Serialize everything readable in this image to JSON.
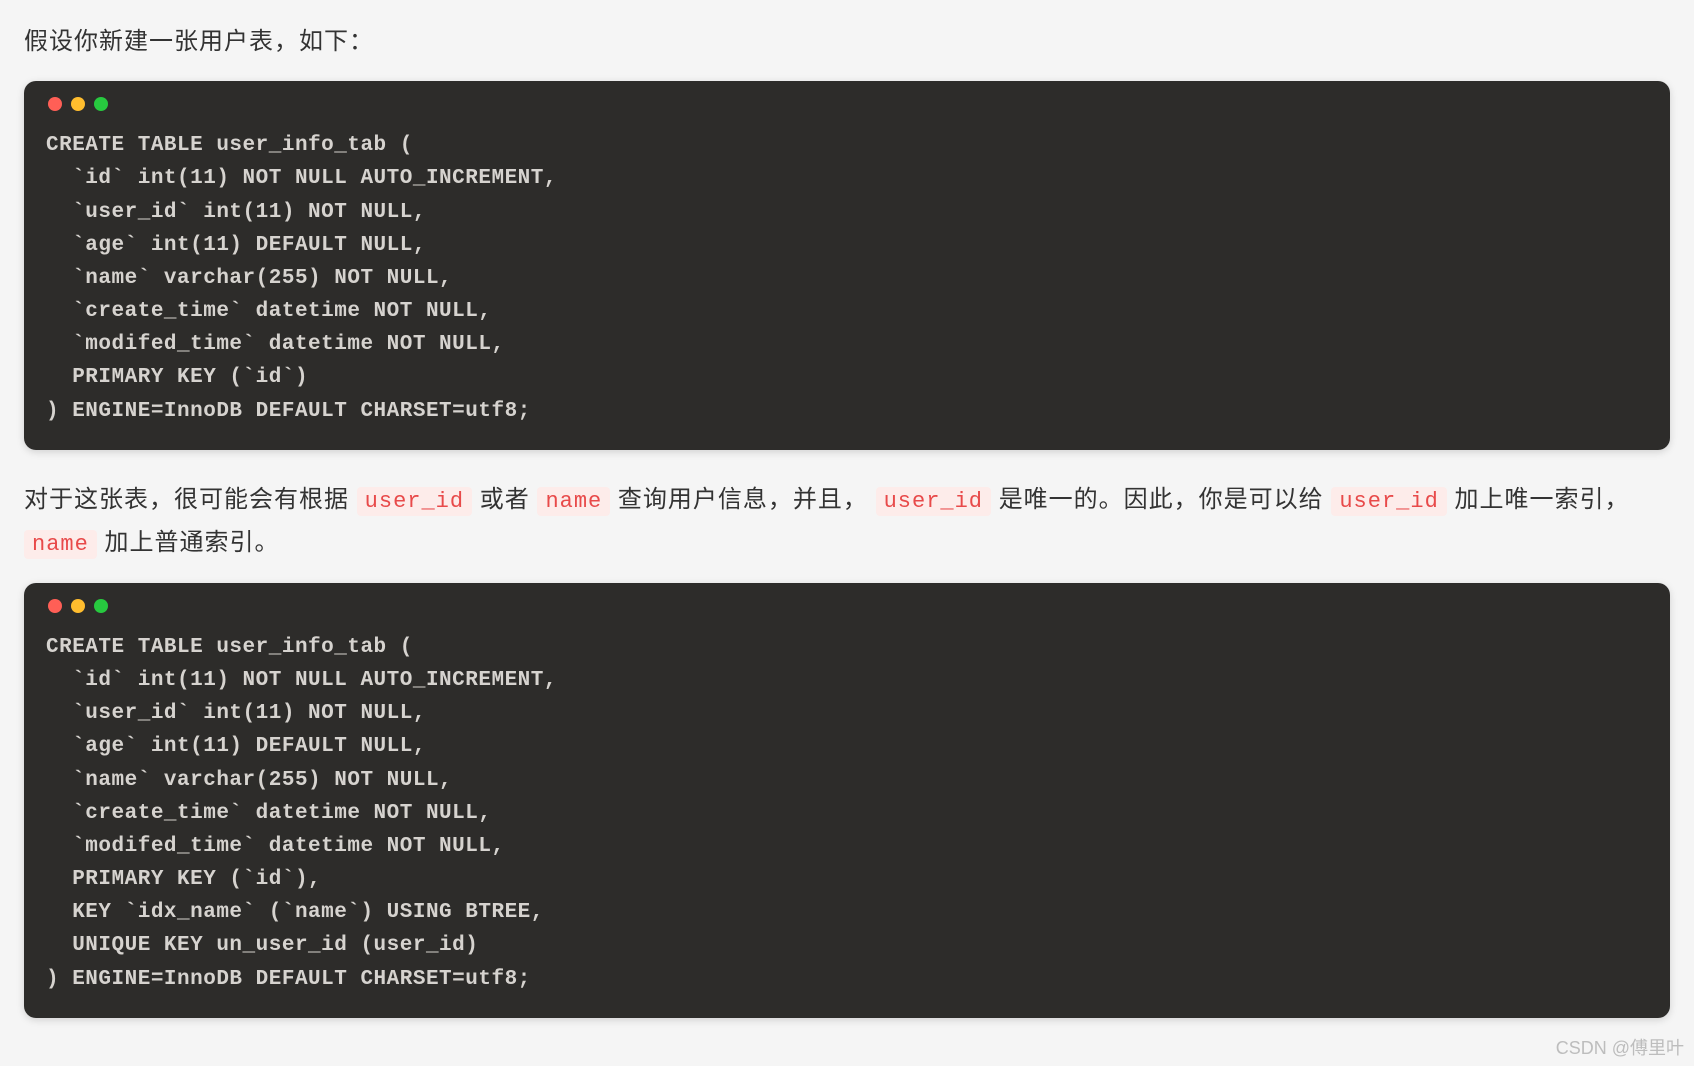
{
  "paragraph1": "假设你新建一张用户表，如下：",
  "code_block_1": "CREATE TABLE user_info_tab (\n  `id` int(11) NOT NULL AUTO_INCREMENT,\n  `user_id` int(11) NOT NULL,\n  `age` int(11) DEFAULT NULL,\n  `name` varchar(255) NOT NULL,\n  `create_time` datetime NOT NULL,\n  `modifed_time` datetime NOT NULL,\n  PRIMARY KEY (`id`)\n) ENGINE=InnoDB DEFAULT CHARSET=utf8;",
  "paragraph2": {
    "seg1": "对于这张表，很可能会有根据 ",
    "code1": "user_id",
    "seg2": " 或者 ",
    "code2": "name",
    "seg3": " 查询用户信息，并且， ",
    "code3": "user_id",
    "seg4": " 是唯一的。因此，你是可以给 ",
    "code4": "user_id",
    "seg5": " 加上唯一索引， ",
    "code5": "name",
    "seg6": " 加上普通索引。"
  },
  "code_block_2": "CREATE TABLE user_info_tab (\n  `id` int(11) NOT NULL AUTO_INCREMENT,\n  `user_id` int(11) NOT NULL,\n  `age` int(11) DEFAULT NULL,\n  `name` varchar(255) NOT NULL,\n  `create_time` datetime NOT NULL,\n  `modifed_time` datetime NOT NULL,\n  PRIMARY KEY (`id`),\n  KEY `idx_name` (`name`) USING BTREE,\n  UNIQUE KEY un_user_id (user_id)\n) ENGINE=InnoDB DEFAULT CHARSET=utf8;",
  "watermark": "CSDN @傅里叶"
}
